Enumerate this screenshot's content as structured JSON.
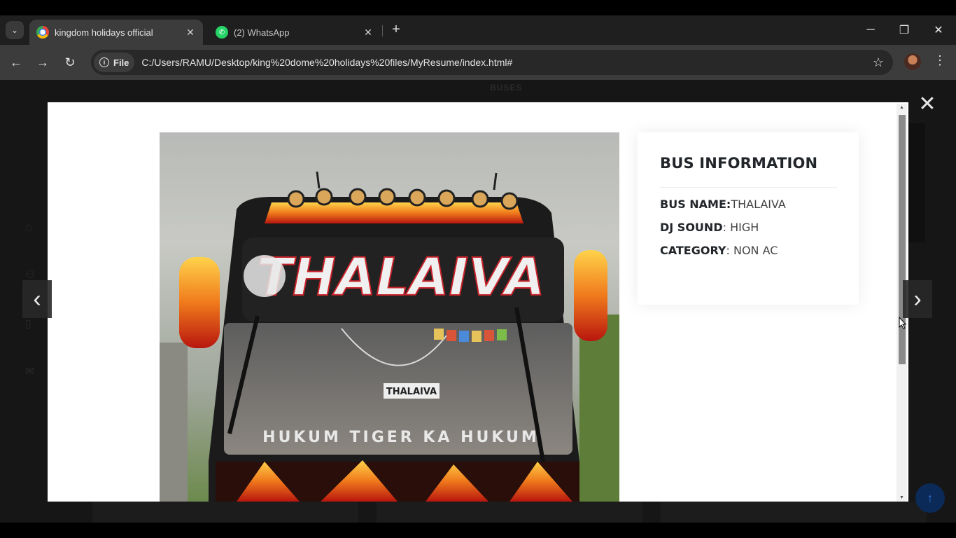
{
  "browser": {
    "tabs": [
      {
        "title": "kingdom holidays official",
        "active": true,
        "icon": "chrome-icon"
      },
      {
        "title": "(2) WhatsApp",
        "active": false,
        "icon": "whatsapp-icon"
      }
    ],
    "new_tab_symbol": "+",
    "window_controls": {
      "minimize": "─",
      "restore": "❐",
      "close": "✕"
    },
    "nav": {
      "back": "←",
      "forward": "→",
      "reload": "↻"
    },
    "address_bar": {
      "scheme_label": "File",
      "url": "C:/Users/RAMU/Desktop/king%20dome%20holidays%20files/MyResume/index.html#"
    },
    "bookmark_symbol": "☆",
    "menu_symbol": "⋮"
  },
  "page": {
    "background_section_label": "BUSES"
  },
  "lightbox": {
    "close_symbol": "✕",
    "prev_symbol": "‹",
    "next_symbol": "›",
    "scroll_top_symbol": "↑",
    "image": {
      "destination_text": "THALAIVA",
      "small_sign": "THALAIVA",
      "windshield_text": "HUKUM TIGER KA HUKUM"
    },
    "info": {
      "title": "BUS INFORMATION",
      "rows": [
        {
          "label": "BUS NAME:",
          "value": "THALAIVA"
        },
        {
          "label": "DJ SOUND",
          "sep": ": ",
          "value": "HIGH"
        },
        {
          "label": "CATEGORY",
          "sep": ": ",
          "value": "NON AC"
        }
      ]
    }
  },
  "colors": {
    "accent_blue": "#0b2a58",
    "modal_bg": "#ffffff",
    "overlay_bg": "#161616"
  }
}
